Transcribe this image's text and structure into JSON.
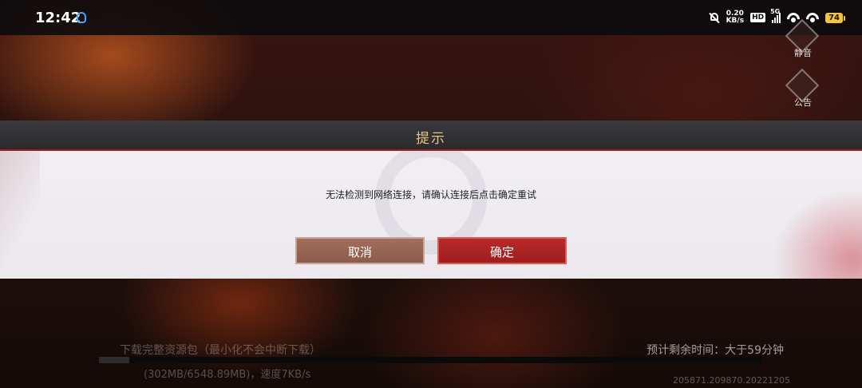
{
  "status_bar": {
    "time": "12:42",
    "net_speed_value": "0.20",
    "net_speed_unit": "KB/s",
    "hd_label": "HD",
    "network_label": "5G",
    "battery": "74"
  },
  "side_menu": {
    "mute_label": "静音",
    "notice_label": "公告"
  },
  "dialog": {
    "title": "提示",
    "message": "无法检测到网络连接，请确认连接后点击确定重试",
    "cancel_label": "取消",
    "confirm_label": "确定"
  },
  "download": {
    "status_text": "下载完整资源包（最小化不会中断下载）",
    "remaining_time": "预计剩余时间：大于59分钟",
    "progress_detail": "(302MB/6548.89MB)，速度7KB/s",
    "progress_fraction": 0.046,
    "version": "205871.209870.20221205"
  }
}
